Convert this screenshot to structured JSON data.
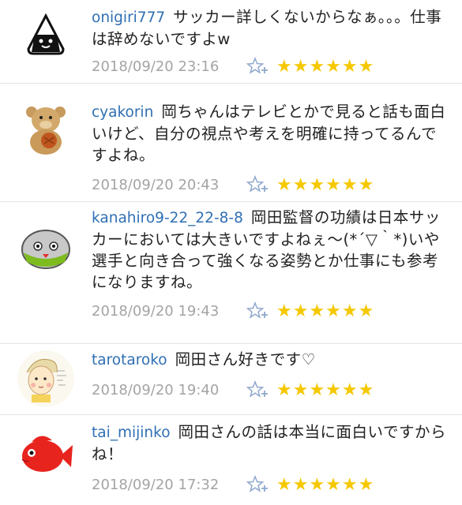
{
  "comments": [
    {
      "user": "onigiri777",
      "text": "サッカー詳しくないからなぁ。。。仕事は辞めないですよw",
      "date": "2018/09/20 23:16",
      "stars": "★★★★★★",
      "avatar": "onigiri-avatar"
    },
    {
      "user": "cyakorin",
      "text": "岡ちゃんはテレビとかで見ると話も面白いけど、自分の視点や考えを明確に持ってるんですよね。",
      "date": "2018/09/20 20:43",
      "stars": "★★★★★★",
      "avatar": "teddy-bear-avatar"
    },
    {
      "user": "kanahiro9-22_22-8-8",
      "text": "岡田監督の功績は日本サッカーにおいては大きいですよねぇ〜(*´▽｀*)いや選手と向き合って強くなる姿勢とか仕事にも参考になりますね。",
      "date": "2018/09/20 19:43",
      "stars": "★★★★★★",
      "avatar": "robot-avatar"
    },
    {
      "user": "tarotaroko",
      "text": "岡田さん好きです♡",
      "date": "2018/09/20 19:40",
      "stars": "★★★★★★",
      "avatar": "sketch-avatar"
    },
    {
      "user": "tai_mijinko",
      "text": "岡田さんの話は本当に面白いですからね！",
      "date": "2018/09/20 17:32",
      "stars": "★★★★★★",
      "avatar": "red-fish-avatar"
    }
  ],
  "colors": {
    "username": "#2f6fb3",
    "date": "#a4a4a4",
    "star": "#f5c800",
    "add_icon": "#8fa8cc"
  }
}
